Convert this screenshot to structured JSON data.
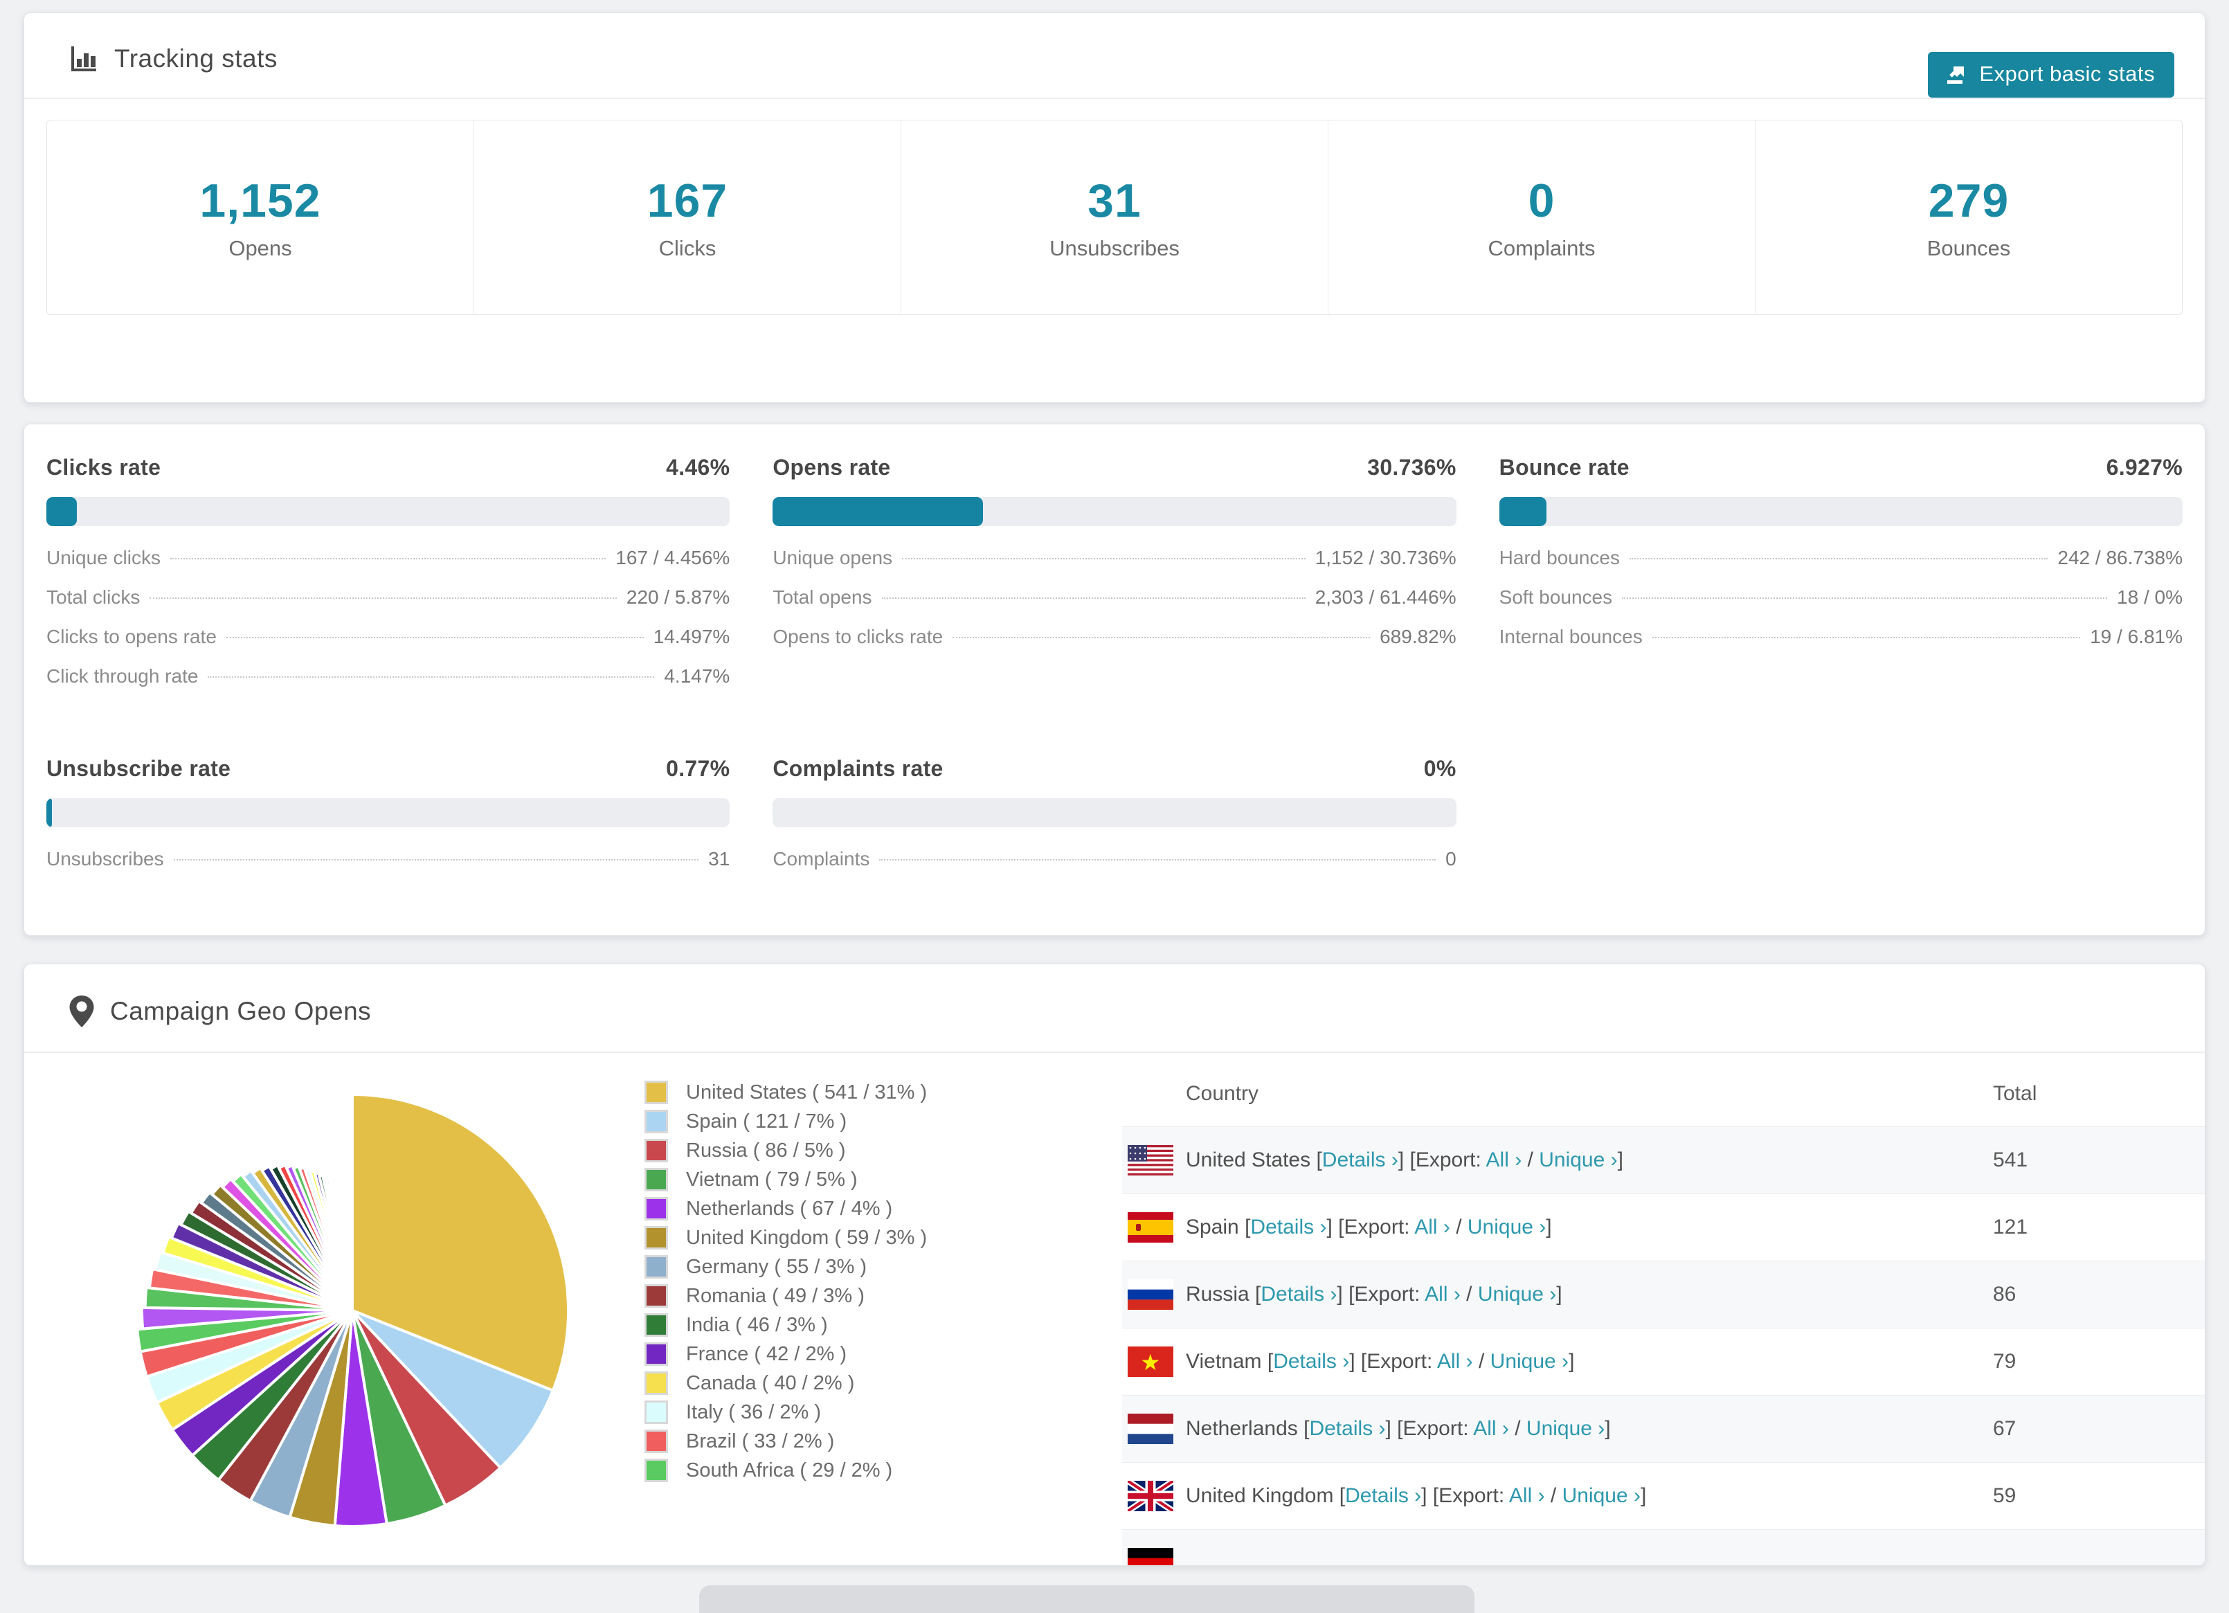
{
  "colors": {
    "teal_accent": "#1a89a4",
    "button_bg": "#17869e",
    "link": "#2d98ae",
    "bar_fill": "#1584a3",
    "bar_track": "#ebedf1"
  },
  "tracking_card": {
    "title": "Tracking stats",
    "icon": "bar-chart-icon",
    "export_button": "Export basic stats",
    "stats": [
      {
        "value": "1,152",
        "label": "Opens"
      },
      {
        "value": "167",
        "label": "Clicks"
      },
      {
        "value": "31",
        "label": "Unsubscribes"
      },
      {
        "value": "0",
        "label": "Complaints"
      },
      {
        "value": "279",
        "label": "Bounces"
      }
    ]
  },
  "rates_card": {
    "blocks": [
      {
        "title": "Clicks rate",
        "value": "4.46%",
        "pct": 4.46,
        "rows": [
          {
            "label": "Unique clicks",
            "value": "167 / 4.456%"
          },
          {
            "label": "Total clicks",
            "value": "220 / 5.87%"
          },
          {
            "label": "Clicks to opens rate",
            "value": "14.497%"
          },
          {
            "label": "Click through rate",
            "value": "4.147%"
          }
        ]
      },
      {
        "title": "Opens rate",
        "value": "30.736%",
        "pct": 30.736,
        "rows": [
          {
            "label": "Unique opens",
            "value": "1,152 / 30.736%"
          },
          {
            "label": "Total opens",
            "value": "2,303 / 61.446%"
          },
          {
            "label": "Opens to clicks rate",
            "value": "689.82%"
          }
        ]
      },
      {
        "title": "Bounce rate",
        "value": "6.927%",
        "pct": 6.927,
        "rows": [
          {
            "label": "Hard bounces",
            "value": "242 / 86.738%"
          },
          {
            "label": "Soft bounces",
            "value": "18 / 0%"
          },
          {
            "label": "Internal bounces",
            "value": "19 / 6.81%"
          }
        ]
      },
      {
        "title": "Unsubscribe rate",
        "value": "0.77%",
        "pct": 0.77,
        "rows": [
          {
            "label": "Unsubscribes",
            "value": "31"
          }
        ]
      },
      {
        "title": "Complaints rate",
        "value": "0%",
        "pct": 0,
        "rows": [
          {
            "label": "Complaints",
            "value": "0"
          }
        ]
      }
    ]
  },
  "geo_card": {
    "title": "Campaign Geo Opens",
    "icon": "map-pin-icon",
    "legend_format": "{label} ( {value} / {pct} )",
    "table": {
      "country_header": "Country",
      "total_header": "Total",
      "details_label": "Details ›",
      "export_prefix": "[Export:",
      "all_label": "All ›",
      "separator": "/",
      "unique_label": "Unique ›",
      "rows": [
        {
          "flag": "us",
          "country": "United States",
          "total": "541",
          "partial": false
        },
        {
          "flag": "es",
          "country": "Spain",
          "total": "121",
          "partial": false
        },
        {
          "flag": "ru",
          "country": "Russia",
          "total": "86",
          "partial": false
        },
        {
          "flag": "vn",
          "country": "Vietnam",
          "total": "79",
          "partial": false
        },
        {
          "flag": "nl",
          "country": "Netherlands",
          "total": "67",
          "partial": false
        },
        {
          "flag": "gb",
          "country": "United Kingdom",
          "total": "59",
          "partial": false
        },
        {
          "flag": "de",
          "country": "",
          "total": "",
          "partial": true
        }
      ]
    }
  },
  "chart_data": {
    "type": "pie",
    "title": "Campaign Geo Opens",
    "legend_position": "right",
    "start_angle_deg": 0,
    "direction": "clockwise",
    "slices": [
      {
        "label": "United States",
        "value": 541,
        "pct": "31%",
        "color": "#e3bf47"
      },
      {
        "label": "Spain",
        "value": 121,
        "pct": "7%",
        "color": "#abd4f2"
      },
      {
        "label": "Russia",
        "value": 86,
        "pct": "5%",
        "color": "#c8484e"
      },
      {
        "label": "Vietnam",
        "value": 79,
        "pct": "5%",
        "color": "#4aa851"
      },
      {
        "label": "Netherlands",
        "value": 67,
        "pct": "4%",
        "color": "#9c33ea"
      },
      {
        "label": "United Kingdom",
        "value": 59,
        "pct": "3%",
        "color": "#b2922d"
      },
      {
        "label": "Germany",
        "value": 55,
        "pct": "3%",
        "color": "#8fb0cc"
      },
      {
        "label": "Romania",
        "value": 49,
        "pct": "3%",
        "color": "#9c3a3a"
      },
      {
        "label": "India",
        "value": 46,
        "pct": "3%",
        "color": "#2f7d36"
      },
      {
        "label": "France",
        "value": 42,
        "pct": "2%",
        "color": "#7227c2"
      },
      {
        "label": "Canada",
        "value": 40,
        "pct": "2%",
        "color": "#f6e04e"
      },
      {
        "label": "Italy",
        "value": 36,
        "pct": "2%",
        "color": "#dbfcfc"
      },
      {
        "label": "Brazil",
        "value": 33,
        "pct": "2%",
        "color": "#f15e5e"
      },
      {
        "label": "South Africa",
        "value": 29,
        "pct": "2%",
        "color": "#59cb60"
      }
    ],
    "other_values": [
      28,
      27,
      26,
      25,
      24,
      23,
      22,
      21,
      20,
      19,
      18,
      17,
      16,
      15,
      14,
      13,
      12,
      11,
      10,
      9,
      8,
      8,
      7,
      7,
      6,
      6,
      5,
      5,
      4,
      4,
      3,
      3,
      3,
      2,
      2,
      2,
      2,
      1,
      1,
      1,
      1,
      1,
      1,
      1,
      1,
      1,
      1,
      1,
      1,
      1
    ],
    "other_colors": [
      "#b257f2",
      "#57c25e",
      "#f56868",
      "#e2fbfb",
      "#f8f852",
      "#6030a8",
      "#2d6b31",
      "#8d3038",
      "#5e7b8c",
      "#8f7c28",
      "#de52e4",
      "#70e077",
      "#a9d3f1",
      "#d6b63c",
      "#34349a",
      "#15402a",
      "#ef4444"
    ]
  }
}
